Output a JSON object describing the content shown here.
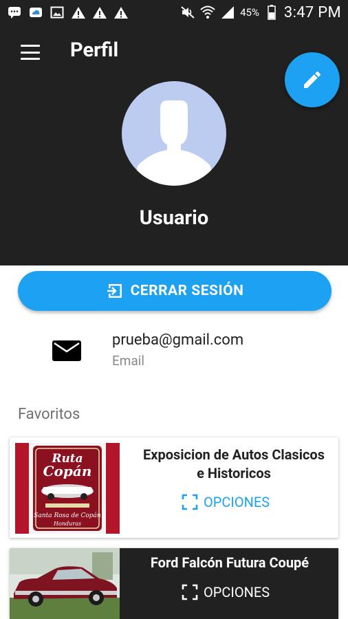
{
  "status_bar": {
    "battery_percent": "45%",
    "time": "3:47 PM",
    "left_icons": [
      "chat-icon",
      "cloud-icon",
      "image-icon",
      "warning-icon",
      "warning-icon",
      "warning-icon"
    ],
    "right_icons": [
      "mute-icon",
      "wifi-icon",
      "signal-icon",
      "battery-icon"
    ]
  },
  "toolbar": {
    "title": "Perfil",
    "menu_icon": "hamburger-icon",
    "edit_icon": "pencil-icon"
  },
  "profile": {
    "name": "Usuario"
  },
  "logout": {
    "label": "CERRAR SESIÓN",
    "icon": "logout-icon"
  },
  "contact": {
    "email": "prueba@gmail.com",
    "email_label": "Email",
    "icon": "mail-icon"
  },
  "favorites": {
    "title": "Favoritos",
    "items": [
      {
        "title": "Exposicion de Autos Clasicos e Historicos",
        "options_label": "OPCIONES",
        "image": "ruta-copan-poster"
      },
      {
        "title": "Ford Falcón Futura Coupé",
        "options_label": "OPCIONES",
        "image": "red-classic-car-photo"
      }
    ]
  },
  "colors": {
    "header_bg": "#212121",
    "accent": "#1da1f2",
    "avatar_bg": "#bccbf0"
  }
}
